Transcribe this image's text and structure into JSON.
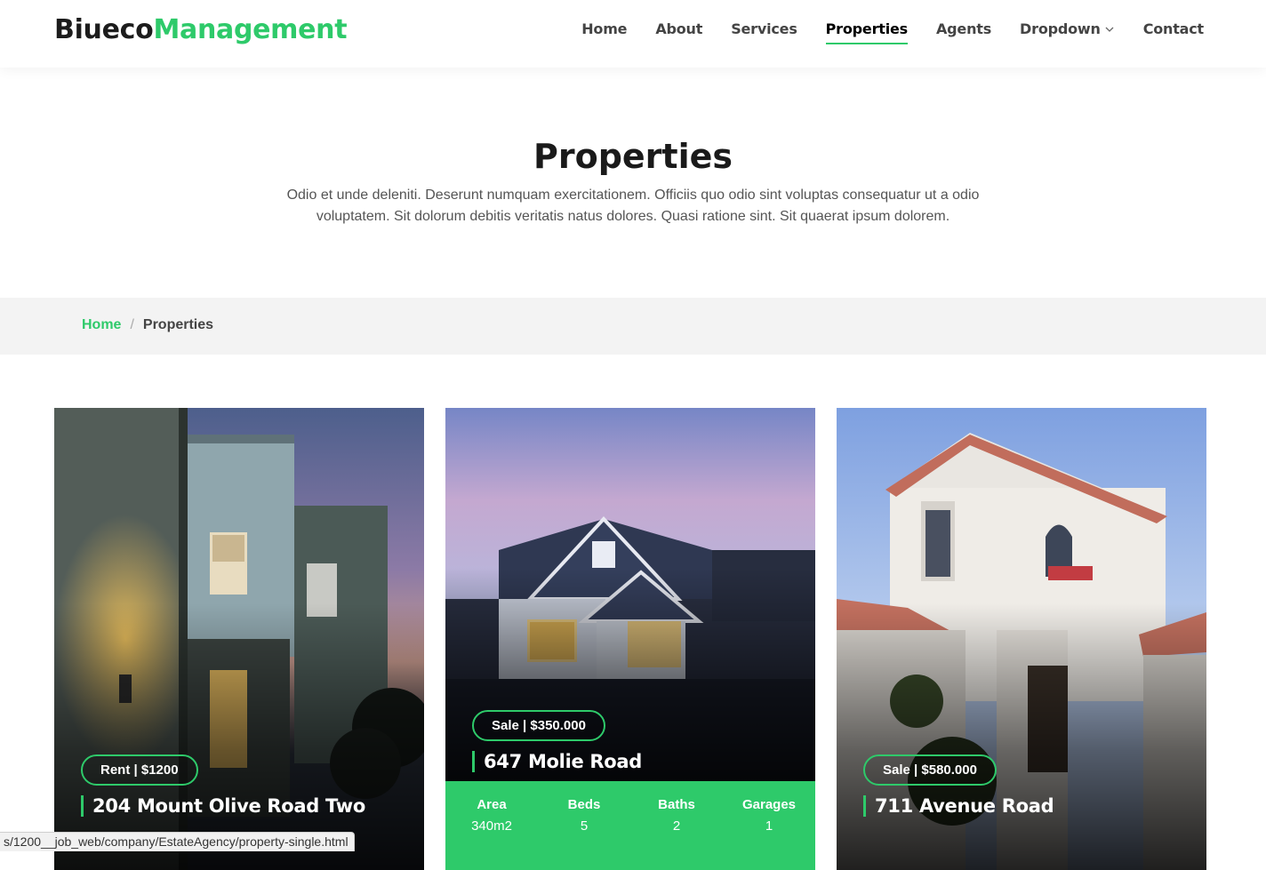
{
  "brand": {
    "part1": "Biueco",
    "part2": "Management"
  },
  "nav": {
    "items": [
      {
        "label": "Home"
      },
      {
        "label": "About"
      },
      {
        "label": "Services"
      },
      {
        "label": "Properties"
      },
      {
        "label": "Agents"
      },
      {
        "label": "Dropdown"
      },
      {
        "label": "Contact"
      }
    ],
    "active": "Properties"
  },
  "intro": {
    "title": "Properties",
    "text": "Odio et unde deleniti. Deserunt numquam exercitationem. Officiis quo odio sint voluptas consequatur ut a odio voluptatem. Sit dolorum debitis veritatis natus dolores. Quasi ratione sint. Sit quaerat ipsum dolorem."
  },
  "breadcrumb": {
    "home": "Home",
    "separator": "/",
    "current": "Properties"
  },
  "colors": {
    "accent": "#2eca6a",
    "text": "#222222",
    "breadcrumb_bg": "#f3f3f3"
  },
  "properties": [
    {
      "price": "Rent | $1200",
      "address": "204 Mount Olive Road Two",
      "image": "modern-house-dusk"
    },
    {
      "price": "Sale | $350.000",
      "address": "647 Molie Road",
      "image": "suburban-house-twilight",
      "stats": [
        {
          "label": "Area",
          "value": "340m2"
        },
        {
          "label": "Beds",
          "value": "5"
        },
        {
          "label": "Baths",
          "value": "2"
        },
        {
          "label": "Garages",
          "value": "1"
        }
      ]
    },
    {
      "price": "Sale | $580.000",
      "address": "711 Avenue Road",
      "image": "white-stucco-house"
    }
  ],
  "status_url": "s/1200__job_web/company/EstateAgency/property-single.html"
}
